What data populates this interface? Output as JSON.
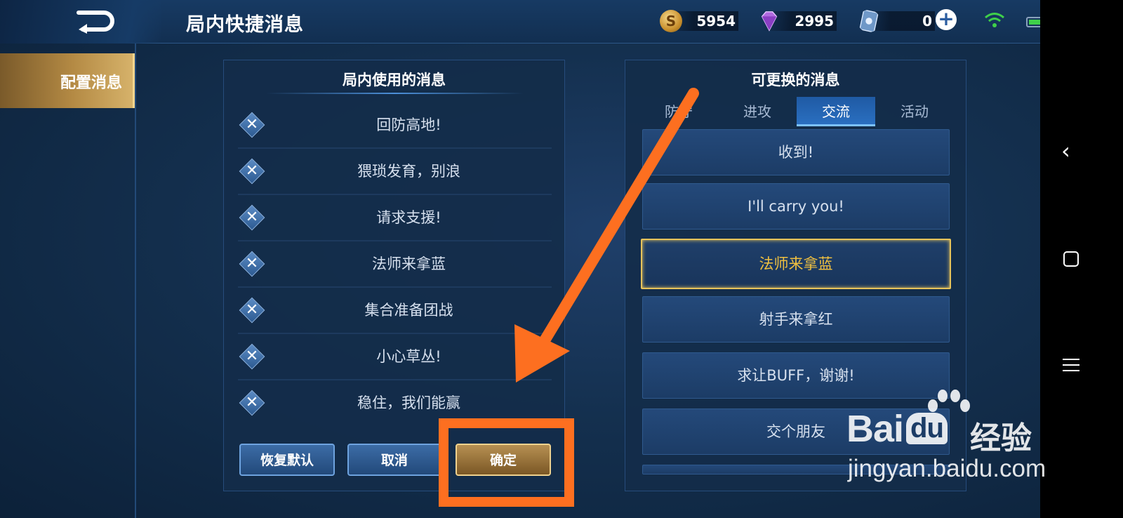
{
  "header": {
    "title": "局内快捷消息",
    "resources": [
      {
        "name": "gold-coin",
        "value": "5954"
      },
      {
        "name": "diamond",
        "value": "2995"
      },
      {
        "name": "ticket-card",
        "value": "0"
      }
    ],
    "coin_glyph": "S"
  },
  "sidebar": {
    "items": [
      {
        "label": "配置消息",
        "active": true
      }
    ]
  },
  "left_panel": {
    "title": "局内使用的消息",
    "messages": [
      "回防高地!",
      "猥琐发育，别浪",
      "请求支援!",
      "法师来拿蓝",
      "集合准备团战",
      "小心草丛!",
      "稳住，我们能赢"
    ],
    "buttons": {
      "restore": "恢复默认",
      "cancel": "取消",
      "confirm": "确定"
    }
  },
  "right_panel": {
    "title": "可更换的消息",
    "tabs": [
      "防守",
      "进攻",
      "交流",
      "活动"
    ],
    "active_tab": "交流",
    "options": [
      "收到!",
      "I'll carry you!",
      "法师来拿蓝",
      "射手来拿红",
      "求让BUFF，谢谢!",
      "交个朋友"
    ],
    "selected_option": "法师来拿蓝"
  },
  "colors": {
    "accent_gold": "#e7c35a",
    "annotation_orange": "#fd6f20",
    "tab_active": "#2a6fc0"
  },
  "watermark": {
    "logo": "Bai",
    "logo_suffix": "du",
    "jingyan": "经验",
    "url": "jingyan.baidu.com"
  }
}
